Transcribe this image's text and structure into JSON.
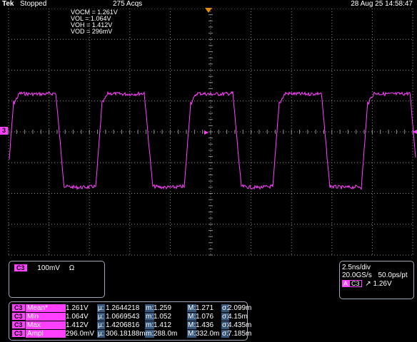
{
  "topbar": {
    "brand": "Tek",
    "status": "Stopped",
    "acquisitions": "275 Acqs",
    "datetime": "28 Aug 25 14:58:47"
  },
  "annotations": [
    "VOCM = 1.261V",
    "VOL = 1.064V",
    "VOH = 1.412V",
    "VOD = 296mV"
  ],
  "channel": {
    "marker": "3",
    "tag": "C3",
    "scale": "100mV",
    "coupling": "Ω",
    "color": "#ff40ff"
  },
  "horizontal": {
    "timebase": "2.5ns/div",
    "sample_rate": "20.0GS/s",
    "resolution": "50.0ps/pt",
    "trigger_source_a": "A",
    "trigger_channel": "C3",
    "trigger_slope": "↗",
    "trigger_level": "1.26V"
  },
  "measurements": [
    {
      "ch": "C3",
      "name": "Mean*",
      "value": "1.261V",
      "mu_label": "µ:",
      "mu": "1.2644218",
      "m_label": "m:",
      "min": "1.259",
      "M_label": "M:",
      "max": "1.271",
      "s_label": "σ:",
      "sigma": "2.099m"
    },
    {
      "ch": "C3",
      "name": "Min",
      "value": "1.064V",
      "mu_label": "µ:",
      "mu": "1.0669543",
      "m_label": "m:",
      "min": "1.052",
      "M_label": "M:",
      "max": "1.076",
      "s_label": "σ:",
      "sigma": "4.15m"
    },
    {
      "ch": "C3",
      "name": "Max",
      "value": "1.412V",
      "mu_label": "µ:",
      "mu": "1.4206816",
      "m_label": "m:",
      "min": "1.412",
      "M_label": "M:",
      "max": "1.436",
      "s_label": "σ:",
      "sigma": "4.435m"
    },
    {
      "ch": "C3",
      "name": "Ampl",
      "value": "296.0mV",
      "mu_label": "µ:",
      "mu": "306.18188m",
      "m_label": "m:",
      "min": "288.0m",
      "M_label": "M:",
      "max": "332.0m",
      "s_label": "σ:",
      "sigma": "7.185m"
    }
  ],
  "colors": {
    "trace": "#ff40ff",
    "grid": "#8a8a8a",
    "trigger_marker": "#f08a00",
    "measurement_label_bg": "#34557a"
  }
}
